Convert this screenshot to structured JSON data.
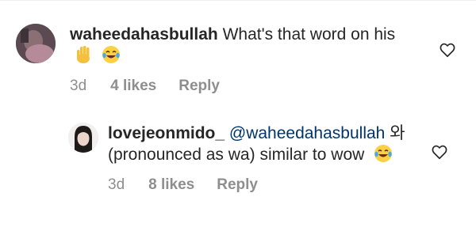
{
  "comments": [
    {
      "username": "waheedahasbullah",
      "text": "What's that word on his",
      "emojis": [
        "raised-hand-emoji",
        "tears-of-joy-emoji"
      ],
      "time": "3d",
      "likes": "4 likes",
      "reply_label": "Reply"
    },
    {
      "username": "lovejeonmido_",
      "mention": "@waheedahasbullah",
      "text": "와 (pronounced as wa) similar to wow",
      "emojis": [
        "tears-of-joy-emoji"
      ],
      "time": "3d",
      "likes": "8 likes",
      "reply_label": "Reply"
    }
  ],
  "colors": {
    "text": "#262626",
    "meta": "#8e8e8e",
    "mention": "#003569"
  }
}
